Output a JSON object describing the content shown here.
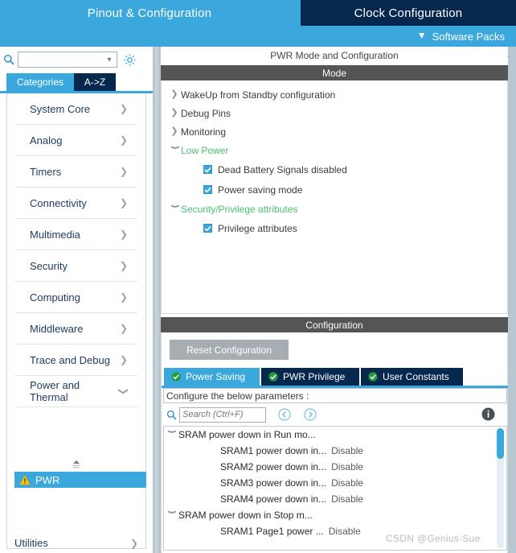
{
  "header": {
    "tabs": [
      {
        "label": "Pinout & Configuration",
        "active": true
      },
      {
        "label": "Clock Configuration",
        "active": false
      }
    ],
    "software_packs": "Software Packs",
    "chevron_icon": "chevron-down-icon"
  },
  "sidebar": {
    "search": {
      "value": "",
      "placeholder": "",
      "icon": "search-icon"
    },
    "gear_icon": "gear-icon",
    "subtabs": [
      {
        "label": "Categories",
        "active": true
      },
      {
        "label": "A->Z",
        "active": false
      }
    ],
    "categories": [
      {
        "label": "System Core",
        "arrow": "chevron-right-icon"
      },
      {
        "label": "Analog",
        "arrow": "chevron-right-icon"
      },
      {
        "label": "Timers",
        "arrow": "chevron-right-icon"
      },
      {
        "label": "Connectivity",
        "arrow": "chevron-right-icon"
      },
      {
        "label": "Multimedia",
        "arrow": "chevron-right-icon"
      },
      {
        "label": "Security",
        "arrow": "chevron-right-icon"
      },
      {
        "label": "Computing",
        "arrow": "chevron-right-icon"
      },
      {
        "label": "Middleware",
        "arrow": "chevron-right-icon"
      },
      {
        "label": "Trace and Debug",
        "arrow": "chevron-right-icon"
      },
      {
        "label": "Power and Thermal",
        "arrow": "chevron-down-icon"
      }
    ],
    "selected_peripheral": {
      "label": "PWR",
      "warning_icon": "warning-triangle-icon"
    },
    "scroll_spinner_icon": "scroll-up-icon",
    "utilities": {
      "label": "Utilities",
      "arrow": "chevron-right-icon"
    }
  },
  "main": {
    "title": "PWR Mode and Configuration",
    "mode_section": {
      "header": "Mode",
      "tree": [
        {
          "label": "WakeUp from Standby configuration",
          "expanded": false,
          "green": false
        },
        {
          "label": "Debug Pins",
          "expanded": false,
          "green": false
        },
        {
          "label": "Monitoring",
          "expanded": false,
          "green": false
        },
        {
          "label": "Low Power",
          "expanded": true,
          "green": true
        },
        {
          "label": "Security/Privilege attributes",
          "expanded": true,
          "green": true
        }
      ],
      "checkboxes": [
        {
          "label": "Dead Battery Signals disabled",
          "checked": true,
          "after": "Low Power"
        },
        {
          "label": "Power saving mode",
          "checked": true,
          "after": "Low Power"
        },
        {
          "label": "Privilege attributes",
          "checked": true,
          "after": "Security/Privilege attributes"
        }
      ]
    },
    "config_section": {
      "header": "Configuration",
      "reset_button": "Reset Configuration",
      "tabs": [
        {
          "label": "Power Saving",
          "active": true,
          "icon": "check-circle-icon"
        },
        {
          "label": "PWR Privilege",
          "active": false,
          "icon": "check-circle-icon"
        },
        {
          "label": "User Constants",
          "active": false,
          "icon": "check-circle-icon"
        }
      ],
      "param_header": "Configure the below parameters :",
      "search": {
        "value": "",
        "placeholder": "Search (Ctrl+F)",
        "icon": "search-icon"
      },
      "nav_back_icon": "circle-back-arrow-icon",
      "nav_forward_icon": "circle-forward-arrow-icon",
      "info_icon": "info-icon",
      "parameters": [
        {
          "name": "SRAM power down in Run mo...",
          "value": "",
          "group": true,
          "expanded": true
        },
        {
          "name": "SRAM1 power down in...",
          "value": "Disable",
          "group": false
        },
        {
          "name": "SRAM2 power down in...",
          "value": "Disable",
          "group": false
        },
        {
          "name": "SRAM3 power down in...",
          "value": "Disable",
          "group": false
        },
        {
          "name": "SRAM4 power down in...",
          "value": "Disable",
          "group": false
        },
        {
          "name": "SRAM power down in Stop m...",
          "value": "",
          "group": true,
          "expanded": true
        },
        {
          "name": "SRAM1 Page1 power ...",
          "value": "Disable",
          "group": false
        }
      ]
    }
  },
  "edge_chevrons": [
    "chevron-left-icon",
    "chevron-left-icon"
  ],
  "watermark": "CSDN @Genius-Sue",
  "colors": {
    "accent_blue": "#3aa8dc",
    "dark_navy": "#06284f",
    "section_gray": "#555555",
    "green_text": "#4cbf72",
    "warning_yellow": "#f5c518"
  }
}
